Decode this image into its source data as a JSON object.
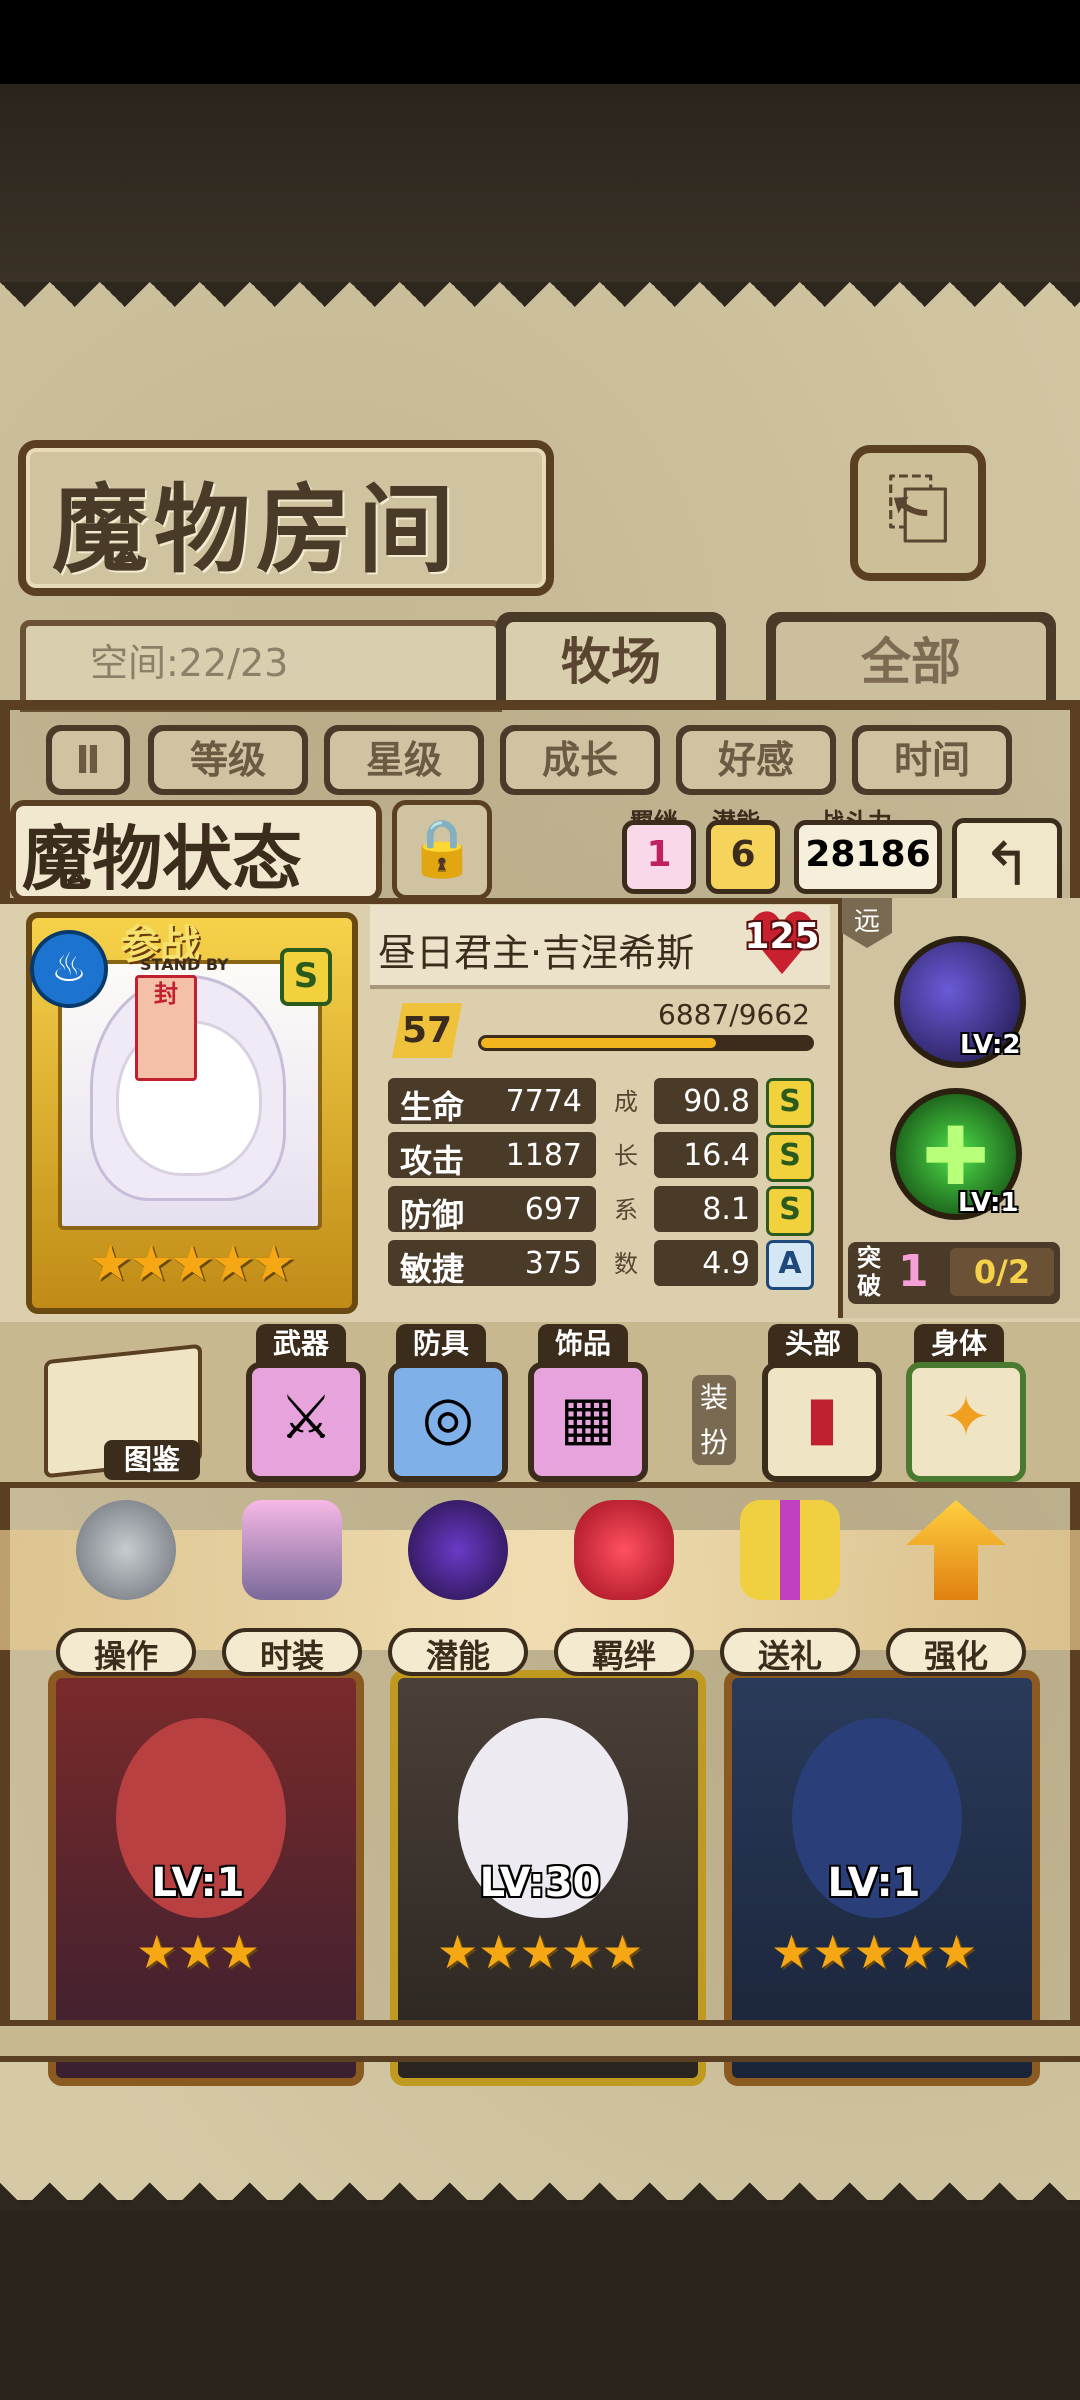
{
  "header": {
    "title": "魔物房间"
  },
  "space": {
    "label": "空间:22/23"
  },
  "tabs": [
    {
      "label": "牧场"
    },
    {
      "label": "全部"
    }
  ],
  "sort": {
    "toggle_glyph": "Ⅱ",
    "options": [
      "等级",
      "星级",
      "成长",
      "好感",
      "时间"
    ]
  },
  "status_panel": {
    "title": "魔物状态",
    "bond": {
      "label": "羁绊",
      "value": "1"
    },
    "potential": {
      "label": "潜能",
      "value": "6"
    },
    "power": {
      "label": "战斗力",
      "value": "28186"
    },
    "card": {
      "standby": "参战",
      "standby_sub": "STAND BY",
      "rank": "S",
      "stars": "★★★★★",
      "tag": "封"
    },
    "name": "昼日君主·吉涅希斯",
    "affection": "125",
    "level": "57",
    "exp_text": "6887/9662",
    "exp_fraction": 0.713,
    "stats": [
      {
        "label": "生命",
        "value": "7774",
        "growth_word": "成",
        "growth": "90.8",
        "grade": "S"
      },
      {
        "label": "攻击",
        "value": "1187",
        "growth_word": "长",
        "growth": "16.4",
        "grade": "S"
      },
      {
        "label": "防御",
        "value": "697",
        "growth_word": "系",
        "growth": "8.1",
        "grade": "S"
      },
      {
        "label": "敏捷",
        "value": "375",
        "growth_word": "数",
        "growth": "4.9",
        "grade": "A"
      }
    ],
    "range": "远",
    "skills": [
      {
        "level": "LV:2"
      },
      {
        "level": "LV:1"
      }
    ],
    "breakthrough": {
      "label": "突破",
      "value": "1",
      "progress": "0/2"
    }
  },
  "equipment": {
    "codex": "图鉴",
    "slots": [
      {
        "label": "武器"
      },
      {
        "label": "防具"
      },
      {
        "label": "饰品"
      }
    ],
    "dress_word": "装扮",
    "dress_slots": [
      {
        "label": "头部"
      },
      {
        "label": "身体"
      }
    ]
  },
  "functions": [
    {
      "label": "操作"
    },
    {
      "label": "时装"
    },
    {
      "label": "潜能"
    },
    {
      "label": "羁绊"
    },
    {
      "label": "送礼"
    },
    {
      "label": "强化"
    }
  ],
  "monsters": [
    {
      "level": "LV:1",
      "stars": "★★★"
    },
    {
      "level": "LV:30",
      "stars": "★★★★★"
    },
    {
      "level": "LV:1",
      "stars": "★★★★★"
    }
  ],
  "colors": {
    "frame": "#5a3f22",
    "parchment": "#d5c9a6",
    "gold": "#f2b51e"
  }
}
